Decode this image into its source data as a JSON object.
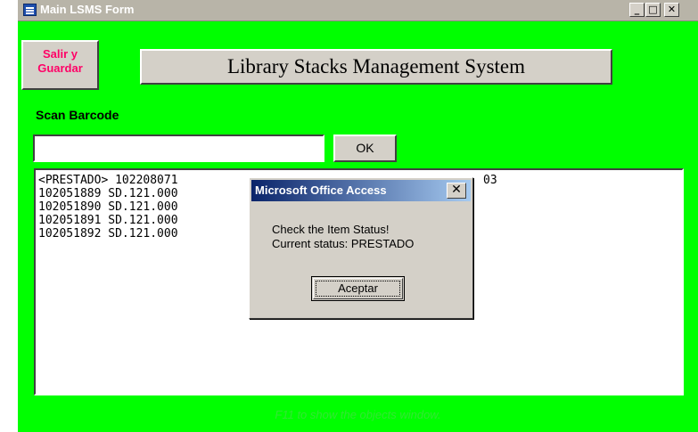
{
  "window": {
    "title": "Main LSMS Form",
    "icon": "form-icon",
    "controls": {
      "minimize": "_",
      "maximize": "□",
      "close": "✕"
    }
  },
  "form": {
    "exit_button_label": "Salir y Guardar",
    "system_title": "Library Stacks Management System",
    "scan_label": "Scan Barcode",
    "barcode_value": "",
    "ok_button_label": "OK",
    "footer_hint": "F11 to show the objects window."
  },
  "list": {
    "items": [
      {
        "text": "<PRESTADO> 102208071",
        "tail": "03"
      },
      {
        "text": "102051889 SD.121.000"
      },
      {
        "text": "102051890 SD.121.000"
      },
      {
        "text": "102051891 SD.121.000"
      },
      {
        "text": "102051892 SD.121.000"
      }
    ]
  },
  "dialog": {
    "title": "Microsoft Office Access",
    "close_label": "✕",
    "message_line1": "Check the Item Status!",
    "message_line2": "Current status: PRESTADO",
    "button_label": "Aceptar"
  },
  "colors": {
    "form_background": "#00ff00",
    "exit_label": "#ff0066",
    "dialog_title_start": "#0a246a",
    "dialog_title_end": "#a6caf0"
  }
}
